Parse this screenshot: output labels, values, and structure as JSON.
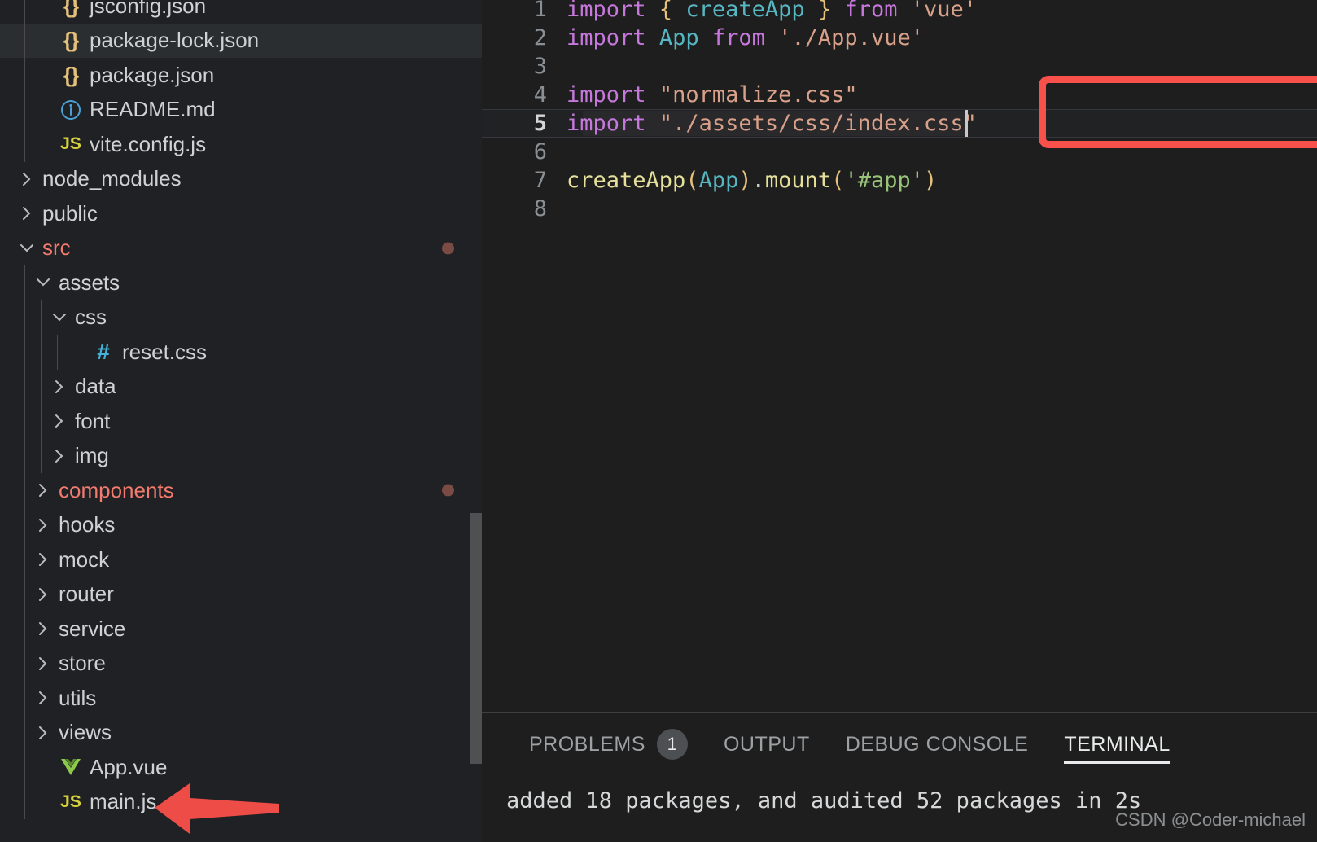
{
  "sidebar": {
    "name": "explorer-file-tree",
    "scrollbar_visible": true,
    "items": [
      {
        "label": "jsconfig.json",
        "icon": "json-braces-icon",
        "kind": "file",
        "depth": 1,
        "clipped": true,
        "selected": false,
        "modified": false
      },
      {
        "label": "package-lock.json",
        "icon": "json-braces-icon",
        "kind": "file",
        "depth": 1,
        "clipped": false,
        "selected": true,
        "modified": false
      },
      {
        "label": "package.json",
        "icon": "json-braces-icon",
        "kind": "file",
        "depth": 1,
        "clipped": false,
        "selected": false,
        "modified": false
      },
      {
        "label": "README.md",
        "icon": "info-circle-icon",
        "kind": "file",
        "depth": 1,
        "clipped": false,
        "selected": false,
        "modified": false
      },
      {
        "label": "vite.config.js",
        "icon": "js-icon",
        "kind": "file",
        "depth": 1,
        "clipped": false,
        "selected": false,
        "modified": false
      },
      {
        "label": "node_modules",
        "icon": "chevron-right-icon",
        "kind": "folder-collapsed",
        "depth": 0,
        "clipped": false,
        "selected": false,
        "modified": false
      },
      {
        "label": "public",
        "icon": "chevron-right-icon",
        "kind": "folder-collapsed",
        "depth": 0,
        "clipped": false,
        "selected": false,
        "modified": false
      },
      {
        "label": "src",
        "icon": "chevron-down-icon",
        "kind": "folder-expanded",
        "depth": 0,
        "clipped": false,
        "selected": false,
        "modified": true,
        "highlight": true
      },
      {
        "label": "assets",
        "icon": "chevron-down-icon",
        "kind": "folder-expanded",
        "depth": 1,
        "clipped": false,
        "selected": false,
        "modified": false
      },
      {
        "label": "css",
        "icon": "chevron-down-icon",
        "kind": "folder-expanded",
        "depth": 2,
        "clipped": false,
        "selected": false,
        "modified": false
      },
      {
        "label": "reset.css",
        "icon": "css-hash-icon",
        "kind": "file",
        "depth": 3,
        "clipped": false,
        "selected": false,
        "modified": false
      },
      {
        "label": "data",
        "icon": "chevron-right-icon",
        "kind": "folder-collapsed",
        "depth": 2,
        "clipped": false,
        "selected": false,
        "modified": false
      },
      {
        "label": "font",
        "icon": "chevron-right-icon",
        "kind": "folder-collapsed",
        "depth": 2,
        "clipped": false,
        "selected": false,
        "modified": false
      },
      {
        "label": "img",
        "icon": "chevron-right-icon",
        "kind": "folder-collapsed",
        "depth": 2,
        "clipped": false,
        "selected": false,
        "modified": false
      },
      {
        "label": "components",
        "icon": "chevron-right-icon",
        "kind": "folder-collapsed",
        "depth": 1,
        "clipped": false,
        "selected": false,
        "modified": true,
        "highlight": true
      },
      {
        "label": "hooks",
        "icon": "chevron-right-icon",
        "kind": "folder-collapsed",
        "depth": 1,
        "clipped": false,
        "selected": false,
        "modified": false
      },
      {
        "label": "mock",
        "icon": "chevron-right-icon",
        "kind": "folder-collapsed",
        "depth": 1,
        "clipped": false,
        "selected": false,
        "modified": false
      },
      {
        "label": "router",
        "icon": "chevron-right-icon",
        "kind": "folder-collapsed",
        "depth": 1,
        "clipped": false,
        "selected": false,
        "modified": false
      },
      {
        "label": "service",
        "icon": "chevron-right-icon",
        "kind": "folder-collapsed",
        "depth": 1,
        "clipped": false,
        "selected": false,
        "modified": false
      },
      {
        "label": "store",
        "icon": "chevron-right-icon",
        "kind": "folder-collapsed",
        "depth": 1,
        "clipped": false,
        "selected": false,
        "modified": false
      },
      {
        "label": "utils",
        "icon": "chevron-right-icon",
        "kind": "folder-collapsed",
        "depth": 1,
        "clipped": false,
        "selected": false,
        "modified": false
      },
      {
        "label": "views",
        "icon": "chevron-right-icon",
        "kind": "folder-collapsed",
        "depth": 1,
        "clipped": false,
        "selected": false,
        "modified": false
      },
      {
        "label": "App.vue",
        "icon": "vue-icon",
        "kind": "file",
        "depth": 1,
        "clipped": false,
        "selected": false,
        "modified": false
      },
      {
        "label": "main.js",
        "icon": "js-icon",
        "kind": "file",
        "depth": 1,
        "clipped": false,
        "selected": false,
        "modified": false
      }
    ]
  },
  "editor": {
    "name": "code-editor-main-js",
    "gutter_numbers": [
      "1",
      "2",
      "3",
      "4",
      "5",
      "6",
      "7",
      "8"
    ],
    "active_line": 5,
    "cursor_line": 5,
    "lines": [
      {
        "n": "1",
        "tokens": [
          {
            "t": "import",
            "c": "kw"
          },
          {
            "t": " ",
            "c": "punc"
          },
          {
            "t": "{",
            "c": "brc"
          },
          {
            "t": " ",
            "c": "punc"
          },
          {
            "t": "createApp",
            "c": "id"
          },
          {
            "t": " ",
            "c": "punc"
          },
          {
            "t": "}",
            "c": "brc"
          },
          {
            "t": " ",
            "c": "punc"
          },
          {
            "t": "from",
            "c": "kw"
          },
          {
            "t": " ",
            "c": "punc"
          },
          {
            "t": "'vue'",
            "c": "str"
          }
        ]
      },
      {
        "n": "2",
        "tokens": [
          {
            "t": "import",
            "c": "kw"
          },
          {
            "t": " ",
            "c": "punc"
          },
          {
            "t": "App",
            "c": "id"
          },
          {
            "t": " ",
            "c": "punc"
          },
          {
            "t": "from",
            "c": "kw"
          },
          {
            "t": " ",
            "c": "punc"
          },
          {
            "t": "'./App.vue'",
            "c": "str"
          }
        ]
      },
      {
        "n": "3",
        "tokens": []
      },
      {
        "n": "4",
        "tokens": [
          {
            "t": "import",
            "c": "kw"
          },
          {
            "t": " ",
            "c": "punc"
          },
          {
            "t": "\"normalize.css\"",
            "c": "str"
          }
        ]
      },
      {
        "n": "5",
        "tokens": [
          {
            "t": "import",
            "c": "kw"
          },
          {
            "t": " ",
            "c": "punc"
          },
          {
            "t": "\"./assets/css/index.css\"",
            "c": "str"
          }
        ]
      },
      {
        "n": "6",
        "tokens": []
      },
      {
        "n": "7",
        "tokens": [
          {
            "t": "createApp",
            "c": "fn"
          },
          {
            "t": "(",
            "c": "paren"
          },
          {
            "t": "App",
            "c": "id"
          },
          {
            "t": ")",
            "c": "paren"
          },
          {
            "t": ".",
            "c": "punc"
          },
          {
            "t": "mount",
            "c": "fn"
          },
          {
            "t": "(",
            "c": "paren"
          },
          {
            "t": "'#app'",
            "c": "str2"
          },
          {
            "t": ")",
            "c": "paren"
          }
        ]
      },
      {
        "n": "8",
        "tokens": []
      }
    ]
  },
  "annotations": {
    "highlight_box": {
      "name": "red-highlight-rectangle",
      "color": "#f8504a",
      "covers_lines": "4-5"
    },
    "arrow": {
      "name": "red-pointer-arrow",
      "color": "#ee4d47",
      "points_to": "main.js",
      "direction": "left"
    }
  },
  "panel": {
    "name": "bottom-panel",
    "tabs": [
      {
        "label": "PROBLEMS",
        "badge": "1",
        "active": false
      },
      {
        "label": "OUTPUT",
        "badge": "",
        "active": false
      },
      {
        "label": "DEBUG CONSOLE",
        "badge": "",
        "active": false
      },
      {
        "label": "TERMINAL",
        "badge": "",
        "active": true
      }
    ],
    "terminal_output": [
      "added 18 packages, and audited 52 packages in 2s"
    ]
  },
  "watermark": {
    "text": "CSDN @Coder-michael"
  },
  "colors": {
    "sidebar_bg": "#202124",
    "editor_bg": "#1e1e1e",
    "selected_row": "#2a2e31",
    "accent_red": "#f8504a",
    "modified_folder": "#f27b6e",
    "modified_dot": "#7a4a45"
  }
}
